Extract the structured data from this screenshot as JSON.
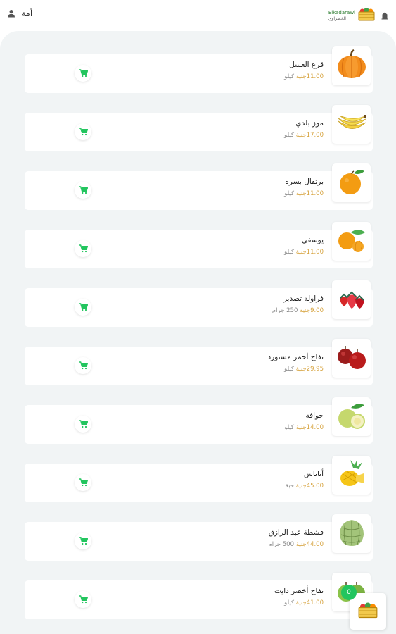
{
  "header": {
    "user_name": "أمة",
    "logo_en": "Elkadarawi",
    "logo_ar": "الخضراوي"
  },
  "products": [
    {
      "name": "قرع العسل",
      "price": "11.00",
      "currency": "جنية",
      "unit": "كيلو",
      "image": "pumpkin"
    },
    {
      "name": "موز بلدي",
      "price": "17.00",
      "currency": "جنية",
      "unit": "كيلو",
      "image": "banana"
    },
    {
      "name": "برتقال بسرة",
      "price": "11.00",
      "currency": "جنية",
      "unit": "كيلو",
      "image": "orange"
    },
    {
      "name": "يوسفي",
      "price": "11.00",
      "currency": "جنية",
      "unit": "كيلو",
      "image": "tangerine"
    },
    {
      "name": "فراولة تصدير",
      "price": "9.00",
      "currency": "جنية",
      "unit": "250 جرام",
      "image": "strawberry"
    },
    {
      "name": "تفاح أحمر مستورد",
      "price": "29.95",
      "currency": "جنية",
      "unit": "كيلو",
      "image": "red-apple"
    },
    {
      "name": "جوافة",
      "price": "14.00",
      "currency": "جنية",
      "unit": "كيلو",
      "image": "guava"
    },
    {
      "name": "أناناس",
      "price": "45.00",
      "currency": "جنية",
      "unit": "حبة",
      "image": "pineapple"
    },
    {
      "name": "قشطة عبد الرازق",
      "price": "44.00",
      "currency": "جنية",
      "unit": "500 جرام",
      "image": "custard-apple"
    },
    {
      "name": "تفاح أخضر دايت",
      "price": "41.00",
      "currency": "جنية",
      "unit": "كيلو",
      "image": "green-apple"
    }
  ],
  "cart": {
    "count": "0"
  },
  "colors": {
    "accent": "#22c55e",
    "price": "#d6a23c",
    "panel": "#f1f4f5"
  }
}
